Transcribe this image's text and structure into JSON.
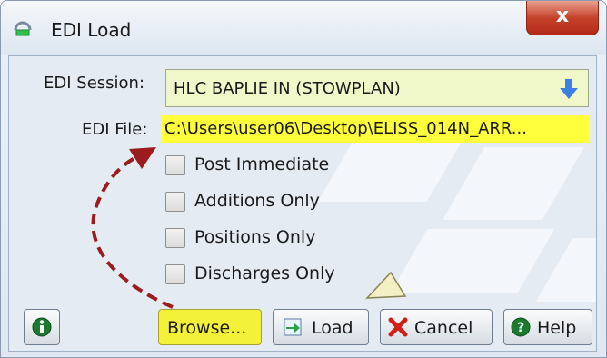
{
  "window": {
    "title": "EDI Load",
    "close_glyph": "x"
  },
  "form": {
    "session_label": "EDI Session:",
    "session_value": "HLC BAPLIE IN (STOWPLAN)",
    "file_label": "EDI File:",
    "file_value": "C:\\Users\\user06\\Desktop\\ELISS_014N_ARR...",
    "file_highlight_color": "#ffff3c",
    "session_bg_color": "#f0f8c9"
  },
  "checkboxes": [
    {
      "label": "Post Immediate",
      "checked": false
    },
    {
      "label": "Additions Only",
      "checked": false
    },
    {
      "label": "Positions Only",
      "checked": false
    },
    {
      "label": "Discharges Only",
      "checked": false
    }
  ],
  "buttons": {
    "info_icon": "info-icon",
    "browse_label": "Browse...",
    "load_label": "Load",
    "cancel_label": "Cancel",
    "help_label": "Help"
  },
  "annotations": {
    "arrow_color": "#9b1c1c",
    "arrow_style": "dashed"
  }
}
